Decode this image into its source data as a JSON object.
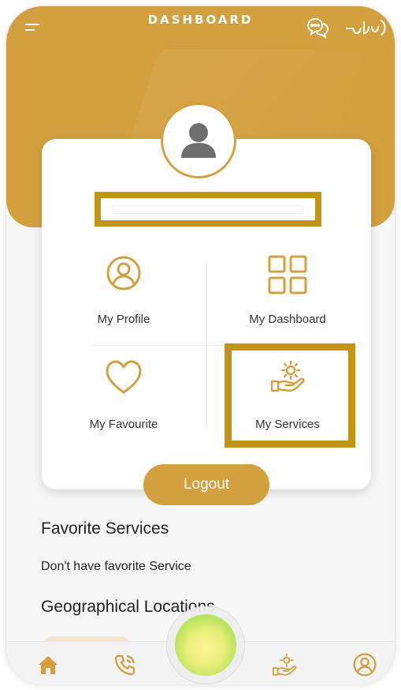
{
  "header": {
    "title": "DASHBOARD"
  },
  "user": {
    "name_redacted": "",
    "name_hint": ""
  },
  "menu": {
    "profile_label": "My Profile",
    "dashboard_label": "My Dashboard",
    "favourite_label": "My Favourite",
    "services_label": "My Services"
  },
  "logout_label": "Logout",
  "sections": {
    "favorite_title": "Favorite Services",
    "favorite_empty": "Don't have favorite Service",
    "geo_title": "Geographical Locations"
  },
  "colors": {
    "accent": "#d4a03f",
    "highlight": "#c19414",
    "text": "#333333"
  },
  "icons": {
    "menu": "hamburger-icon",
    "chat": "chat-icon",
    "profile": "user-circle-icon",
    "dashboard": "grid-icon",
    "favourite": "heart-icon",
    "services": "hand-gear-icon",
    "home": "home-icon",
    "phone": "phone-icon",
    "account": "account-icon"
  },
  "bottom_nav": [
    "home",
    "phone",
    "center",
    "services",
    "account"
  ]
}
